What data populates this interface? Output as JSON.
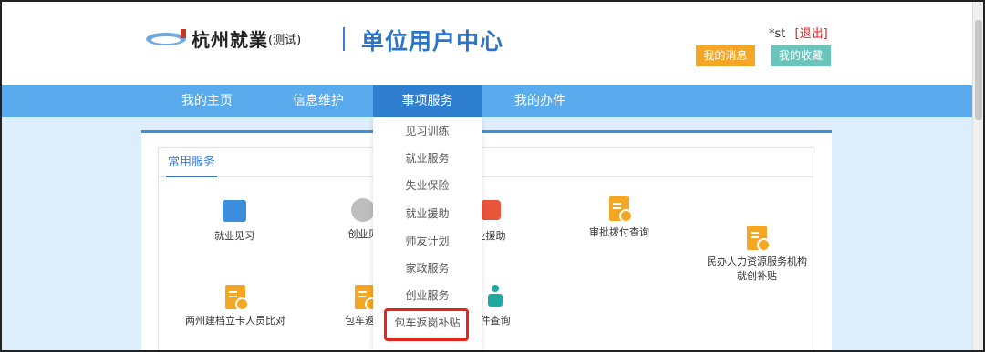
{
  "header": {
    "logo_text": "杭州就業",
    "logo_sub": "(测试)",
    "title": "单位用户中心",
    "user": "*st",
    "logout": "[退出]",
    "my_messages": "我的消息",
    "my_favorites": "我的收藏"
  },
  "nav": {
    "items": [
      "我的主页",
      "信息维护",
      "事项服务",
      "我的办件"
    ],
    "active_index": 2
  },
  "panel": {
    "tab_label": "常用服务"
  },
  "services": [
    {
      "label": "就业见习",
      "icon": "briefcase-icon"
    },
    {
      "label": "创业见",
      "icon": "person-icon"
    },
    {
      "label": "业援助",
      "icon": "handshake-icon"
    },
    {
      "label": "审批拨付查询",
      "icon": "document-check-icon"
    },
    {
      "label": "民办人力资源服务机构\n就创补贴",
      "icon": "document-check-icon"
    },
    {
      "label": "两州建档立卡人员比对",
      "icon": "document-check-icon"
    },
    {
      "label": "包车返岗",
      "icon": "document-check-icon"
    },
    {
      "label": "件查询",
      "icon": "person-location-icon"
    }
  ],
  "dropdown": {
    "items": [
      "见习训练",
      "就业服务",
      "失业保险",
      "就业援助",
      "师友计划",
      "家政服务",
      "创业服务",
      "包车返岗补贴"
    ],
    "highlighted_index": 7
  },
  "colors": {
    "nav_bg": "#5aaaee",
    "nav_active": "#2f7fd0",
    "title_blue": "#2a75c9",
    "msg_btn": "#f5a623",
    "fav_btn": "#69c4bb",
    "highlight": "#e8231c"
  }
}
